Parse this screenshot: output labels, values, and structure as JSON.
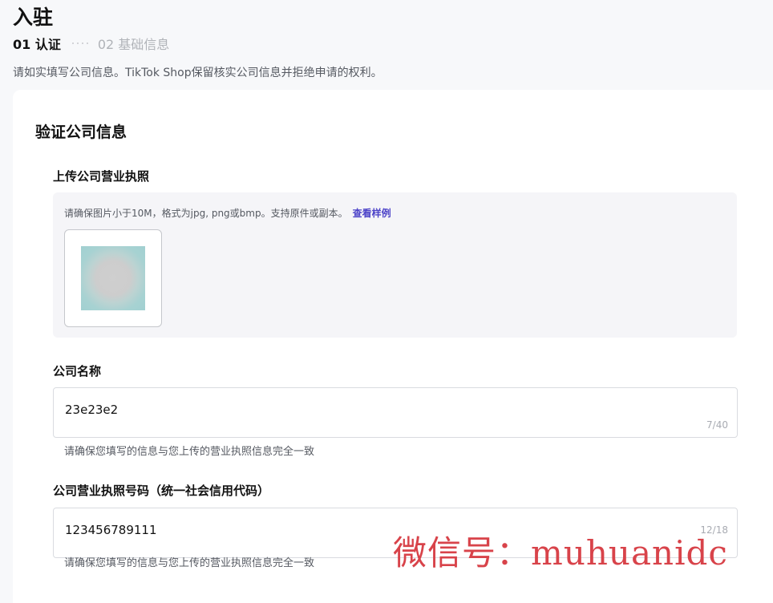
{
  "page": {
    "title": "入驻",
    "steps": [
      {
        "label": "01 认证",
        "active": true
      },
      {
        "label": "02 基础信息",
        "active": false
      }
    ],
    "intro": "请如实填写公司信息。TikTok Shop保留核实公司信息并拒绝申请的权利。"
  },
  "form": {
    "section_title": "验证公司信息",
    "license_upload": {
      "label": "上传公司营业执照",
      "hint": "请确保图片小于10M，格式为jpg, png或bmp。支持原件或副本。",
      "sample_link": "查看样例"
    },
    "company_name": {
      "label": "公司名称",
      "value": "23e23e2",
      "counter": "7/40",
      "help": "请确保您填写的信息与您上传的营业执照信息完全一致"
    },
    "license_number": {
      "label": "公司营业执照号码（统一社会信用代码）",
      "value": "123456789111",
      "counter": "12/18",
      "help": "请确保您填写的信息与您上传的营业执照信息完全一致"
    }
  },
  "watermark": "微信号：muhuanidc",
  "colors": {
    "accent_link": "#4c43c8",
    "page_bg": "#f7f8fa",
    "watermark": "#d8434a"
  }
}
